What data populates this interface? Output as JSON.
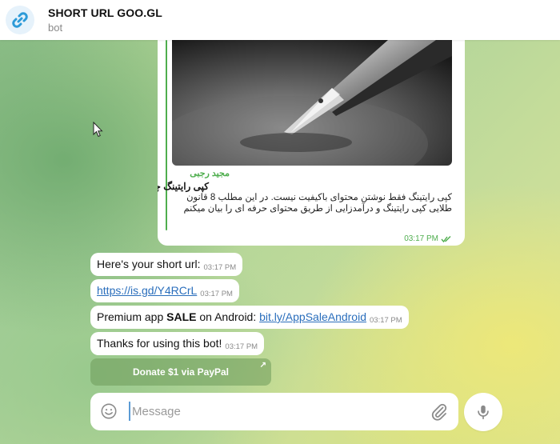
{
  "header": {
    "title": "SHORT URL GOO.GL",
    "subtitle": "bot",
    "avatar_icon": "link-icon",
    "avatar_color": "#2c9ad8"
  },
  "preview": {
    "author": "مجید رجبی",
    "title": "کپی رایتینگ چیست ؟",
    "description": "کپی رایتینگ فقط نوشتن محتوای باکیفیت نیست. در این مطلب 8 قانون طلایی کپی رایتینگ و درآمدزایی از طریق محتوای حرفه ای را بیان میکنم",
    "time": "03:17 PM",
    "image_icon": "fountain-pen-icon",
    "accent_color": "#4fae4e"
  },
  "messages": [
    {
      "text": "Here's your short url:",
      "time": "03:17 PM"
    },
    {
      "link": "https://is.gd/Y4RCrL",
      "time": "03:17 PM"
    },
    {
      "prefix": "Premium app ",
      "bold": "SALE",
      "middle": " on Android: ",
      "link": "bit.ly/AppSaleAndroid",
      "time": "03:17 PM"
    },
    {
      "text": "Thanks for using this bot!",
      "time": "03:17 PM"
    }
  ],
  "inline_button": {
    "label": "Donate $1 via PayPal",
    "arrow": "↗"
  },
  "composer": {
    "placeholder": "Message",
    "emoji_icon": "smile-icon",
    "attach_icon": "paperclip-icon",
    "mic_icon": "microphone-icon"
  },
  "colors": {
    "link": "#2a6ebc",
    "time": "#8a8a8a",
    "read_check": "#4fae4e"
  }
}
